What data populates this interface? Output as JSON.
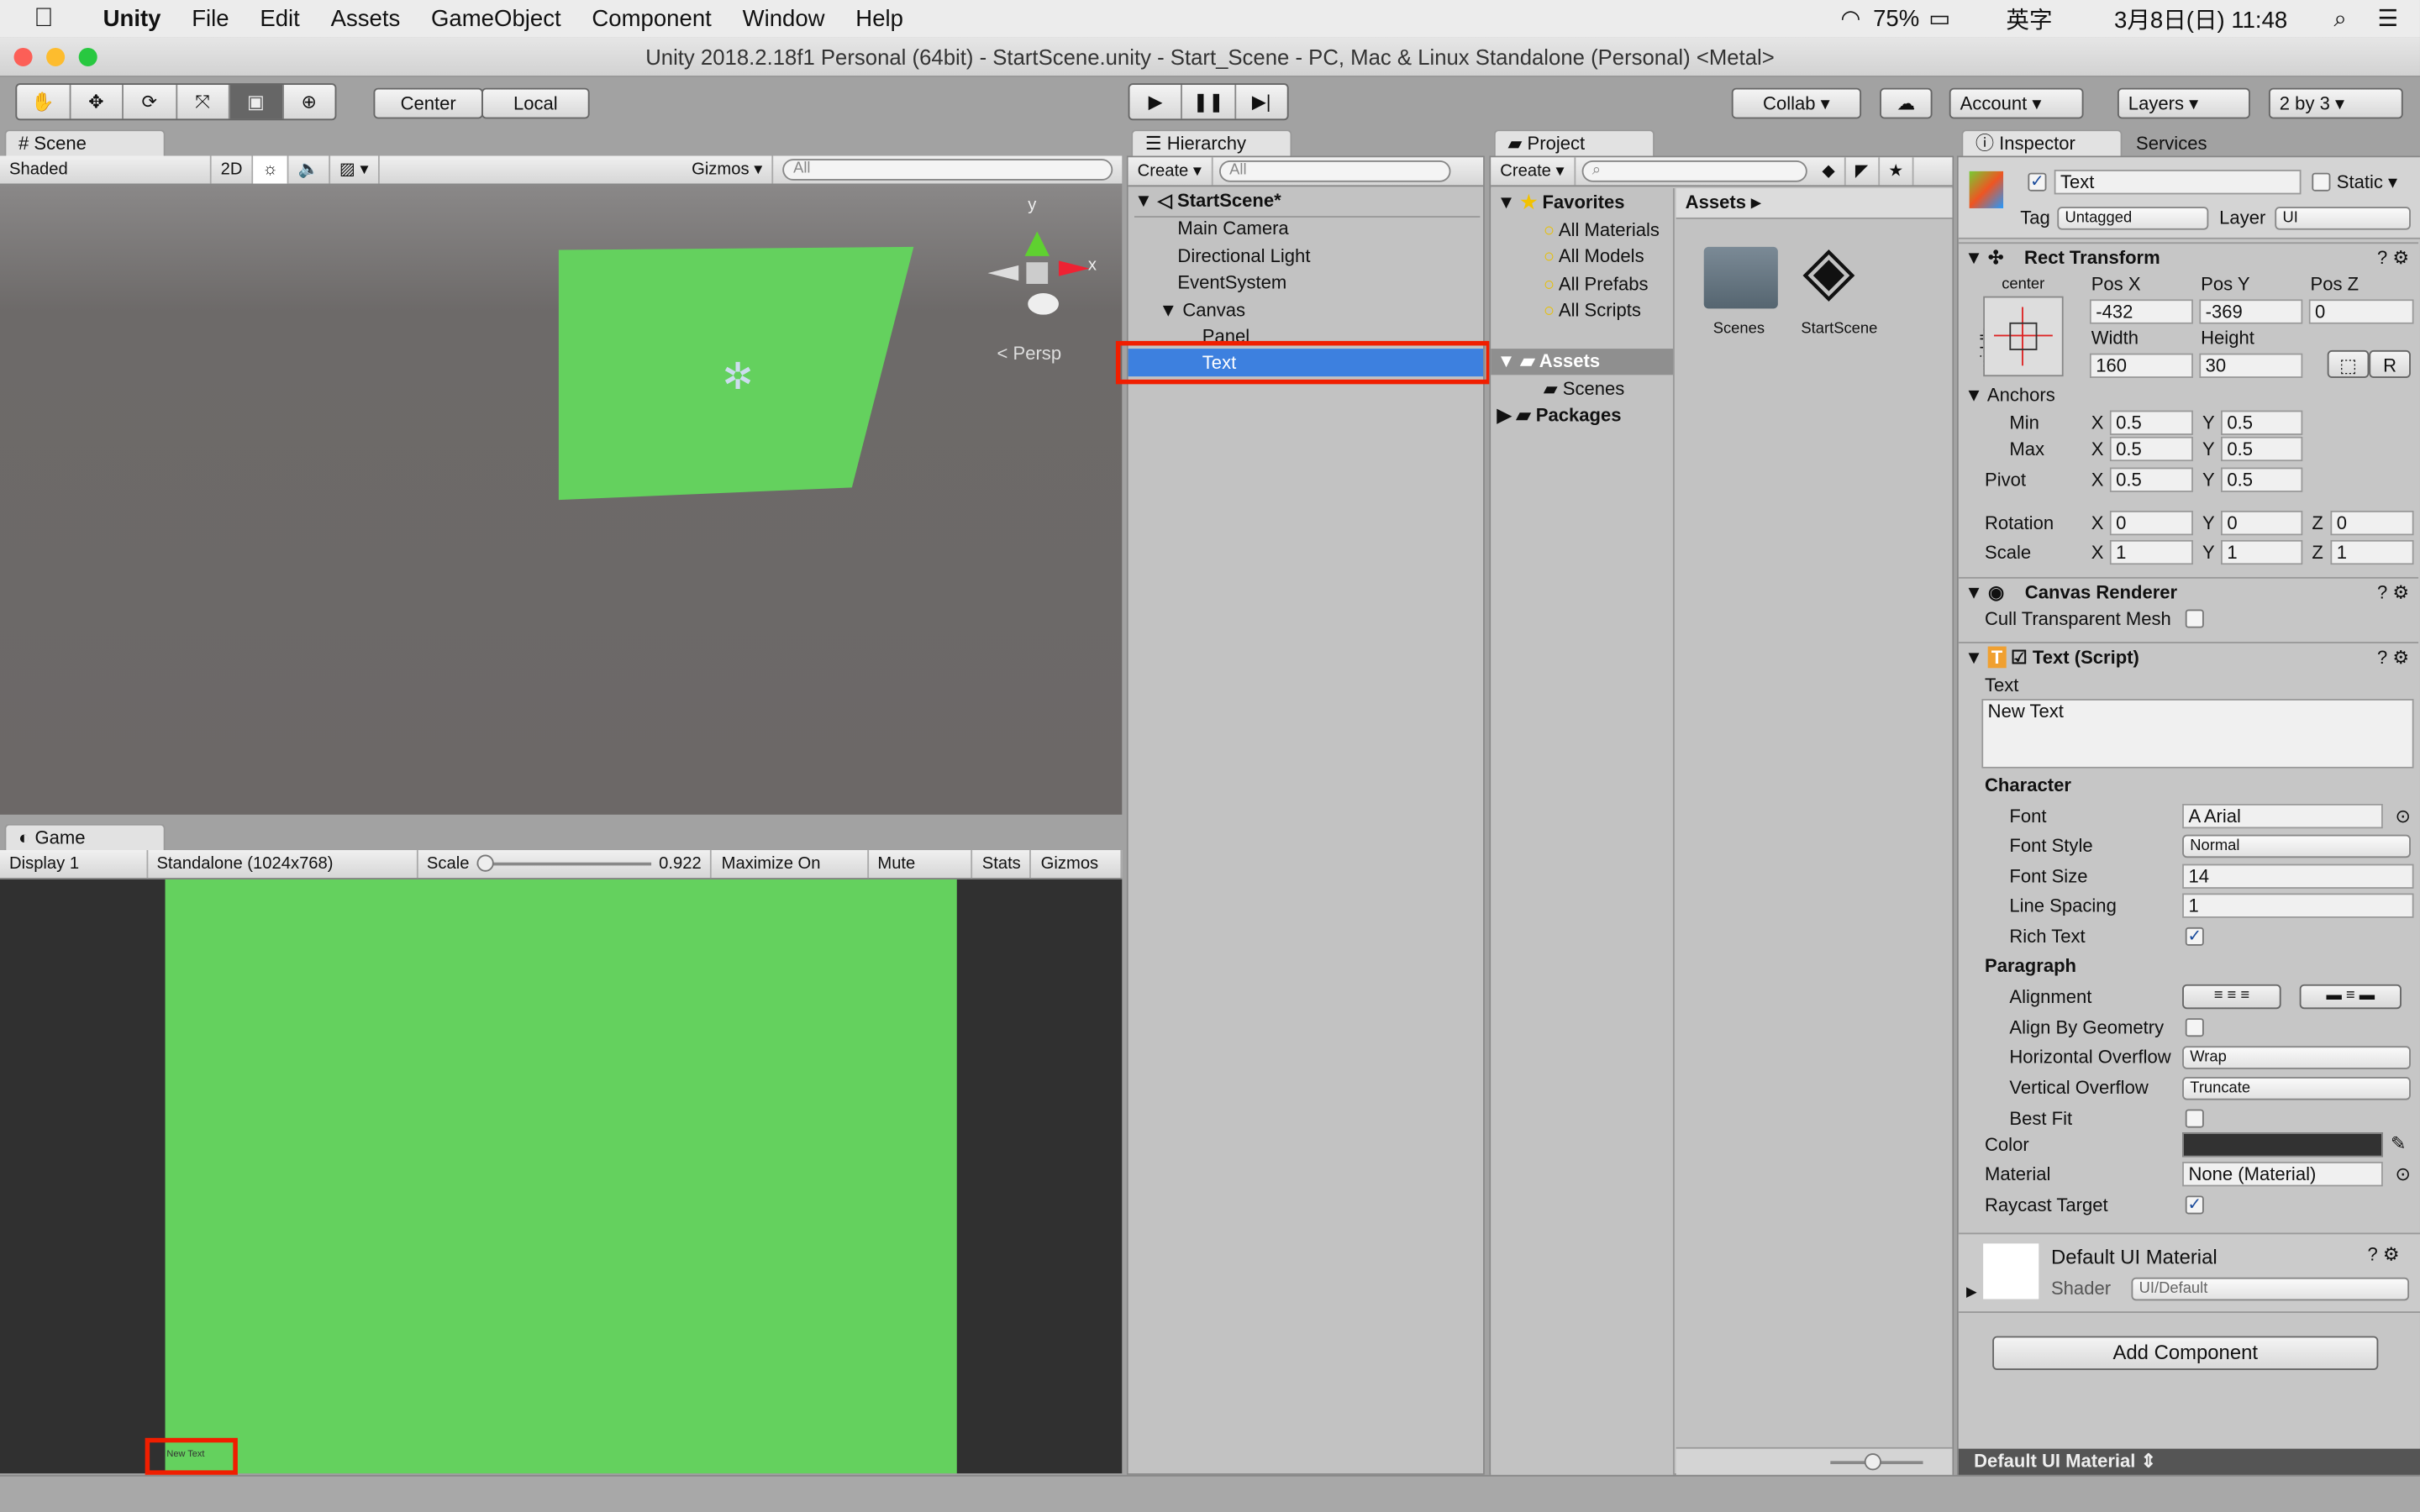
{
  "menubar": {
    "app": "Unity",
    "items": [
      "File",
      "Edit",
      "Assets",
      "GameObject",
      "Component",
      "Window",
      "Help"
    ],
    "battery": "75%",
    "ime": "英字",
    "clock": "3月8日(日) 11:48"
  },
  "window": {
    "title": "Unity 2018.2.18f1 Personal (64bit) - StartScene.unity - Start_Scene - PC, Mac & Linux Standalone (Personal) <Metal>"
  },
  "toolbar": {
    "tools": [
      "hand-tool",
      "move-tool",
      "rotate-tool",
      "scale-tool",
      "rect-tool",
      "transform-tool"
    ],
    "pivot": "Center",
    "space": "Local",
    "collab": "Collab",
    "account": "Account",
    "layers": "Layers",
    "layout": "2 by 3"
  },
  "scene": {
    "tab": "Scene",
    "shading": "Shaded",
    "mode2d": "2D",
    "gizmos": "Gizmos",
    "search_placeholder": "All",
    "persp": "Persp",
    "axis_y": "y",
    "axis_x": "x"
  },
  "game": {
    "tab": "Game",
    "display": "Display 1",
    "resolution": "Standalone (1024x768)",
    "scale_label": "Scale",
    "scale_value": "0.922",
    "maximize": "Maximize On Play",
    "mute": "Mute Audio",
    "stats": "Stats",
    "gizmos": "Gizmos",
    "text_preview": "New Text"
  },
  "hierarchy": {
    "tab": "Hierarchy",
    "create": "Create",
    "search_placeholder": "All",
    "scene": "StartScene*",
    "items": [
      "Main Camera",
      "Directional Light",
      "EventSystem",
      "Canvas",
      "Panel",
      "Text"
    ],
    "selected": "Text"
  },
  "project": {
    "tab": "Project",
    "create": "Create",
    "favorites": "Favorites",
    "fav_items": [
      "All Materials",
      "All Models",
      "All Prefabs",
      "All Scripts"
    ],
    "assets": "Assets",
    "assets_children": [
      "Scenes"
    ],
    "packages": "Packages",
    "breadcrumb": "Assets",
    "files": [
      "Scenes",
      "StartScene"
    ]
  },
  "inspector": {
    "tab": "Inspector",
    "services": "Services",
    "name": "Text",
    "static": "Static",
    "tag_label": "Tag",
    "tag": "Untagged",
    "layer_label": "Layer",
    "layer": "UI",
    "rect": {
      "title": "Rect Transform",
      "anchor_h": "center",
      "anchor_v": "middle",
      "posx_l": "Pos X",
      "posy_l": "Pos Y",
      "posz_l": "Pos Z",
      "posx": "-432",
      "posy": "-369",
      "posz": "0",
      "width_l": "Width",
      "height_l": "Height",
      "width": "160",
      "height": "30",
      "r": "R",
      "anchors": "Anchors",
      "min": "Min",
      "max": "Max",
      "pivot": "Pivot",
      "x": "X",
      "y": "Y",
      "z": "Z",
      "min_x": "0.5",
      "min_y": "0.5",
      "max_x": "0.5",
      "max_y": "0.5",
      "pivot_x": "0.5",
      "pivot_y": "0.5",
      "rotation": "Rotation",
      "rot_x": "0",
      "rot_y": "0",
      "rot_z": "0",
      "scale": "Scale",
      "sc_x": "1",
      "sc_y": "1",
      "sc_z": "1"
    },
    "canvas_renderer": {
      "title": "Canvas Renderer",
      "cull": "Cull Transparent Mesh"
    },
    "text": {
      "title": "Text (Script)",
      "text_label": "Text",
      "text_value": "New Text",
      "character": "Character",
      "font_l": "Font",
      "font": "Arial",
      "style_l": "Font Style",
      "style": "Normal",
      "size_l": "Font Size",
      "size": "14",
      "spacing_l": "Line Spacing",
      "spacing": "1",
      "rich_l": "Rich Text",
      "paragraph": "Paragraph",
      "align_l": "Alignment",
      "geom_l": "Align By Geometry",
      "hover_l": "Horizontal Overflow",
      "hover": "Wrap",
      "vover_l": "Vertical Overflow",
      "vover": "Truncate",
      "best_l": "Best Fit",
      "color_l": "Color",
      "color": "#323232",
      "material_l": "Material",
      "material": "None (Material)",
      "raycast_l": "Raycast Target"
    },
    "material": {
      "name": "Default UI Material",
      "shader_l": "Shader",
      "shader": "UI/Default"
    },
    "add_component": "Add Component",
    "footer": "Default UI Material"
  },
  "colors": {
    "selection": "#3d80df",
    "highlight": "#ff2a00",
    "green": "#64d15e"
  }
}
